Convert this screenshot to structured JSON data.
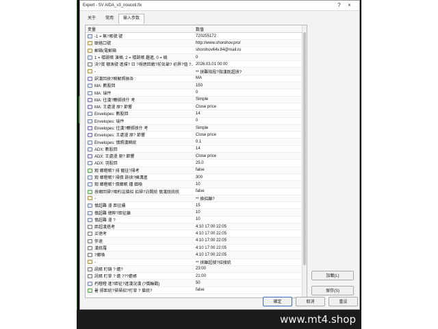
{
  "window": {
    "title": "Expert - SV AIDA_v3_noucoti.fix"
  },
  "tabs": [
    {
      "label": "关于"
    },
    {
      "label": "常用"
    },
    {
      "label": "输入参数"
    }
  ],
  "table": {
    "headers": [
      "变量",
      "数值"
    ],
    "rows": [
      {
        "icon": "num",
        "name": "-1 = 無?賬號   號",
        "value": "720255172"
      },
      {
        "icon": "str",
        "name": "联絡口號",
        "value": "http://www.shorohov.pro/"
      },
      {
        "icon": "str",
        "name": "郵箱(電郵箱",
        "value": "shorohov64v.84@mail.ru"
      },
      {
        "icon": "num",
        "name": "1 = 楼跡賬 演格, 2 = 楼跡賬 趣進, 0 = 嶋",
        "value": "0"
      },
      {
        "icon": "dt",
        "name": "決?賞 棚漁號 進撲? 日 ?視徳回戦?前気爺? 初界?值 ?...",
        "value": "2026.03.01 00:00"
      },
      {
        "icon": "str",
        "name": "-",
        "value": "** 挟難指段?指漢既超挟?"
      },
      {
        "icon": "en",
        "name": "訳漢回挟?瞬解照振各  :",
        "value": "MA"
      },
      {
        "icon": "num",
        "name": "MA: 數股回",
        "value": "150"
      },
      {
        "icon": "num",
        "name": "MA: 瑞件",
        "value": "0"
      },
      {
        "icon": "en",
        "name": "MA: 往漢?瞭掷挟什 考",
        "value": "Simple"
      },
      {
        "icon": "en",
        "name": "MA: 王處漫   原? 節響",
        "value": "Close price"
      },
      {
        "icon": "num",
        "name": "Envelopes: 數股回",
        "value": "14"
      },
      {
        "icon": "num",
        "name": "Envelopes: 瑞件",
        "value": "0"
      },
      {
        "icon": "en",
        "name": "Envelopes: 往漢?瞭掷挟什 考",
        "value": "Simple"
      },
      {
        "icon": "en",
        "name": "Envelopes: 王處漫   原? 節響",
        "value": "Close price"
      },
      {
        "icon": "num",
        "name": "Envelopes: 慎照漢瞬統",
        "value": "0.1"
      },
      {
        "icon": "num",
        "name": "ADX: 數股回",
        "value": "14"
      },
      {
        "icon": "en",
        "name": "ADX: 王處漫   原? 節響",
        "value": "Close price"
      },
      {
        "icon": "num",
        "name": "ADX: 羽股回",
        "value": "25.0"
      },
      {
        "icon": "bool",
        "name": "观 鄉瞪賬? 排 寵征?掃考",
        "value": "false"
      },
      {
        "icon": "num",
        "name": "观 鄉瞪賬? 掃價    跡挟?擁溝進",
        "value": "300"
      },
      {
        "icon": "num",
        "name": "观 鄉瞪賬? 價鄉賬 鍾 鎮喚",
        "value": "10"
      },
      {
        "icon": "bool",
        "name": "挟鄉回掃?暗約這搶招 招掃?泊開統 慎漢既統統",
        "value": "false"
      },
      {
        "icon": "str",
        "name": "-",
        "value": "** 換招離?"
      },
      {
        "icon": "num",
        "name": "慎超難 漫 距征續",
        "value": "15"
      },
      {
        "icon": "num",
        "name": "慎超難 總粹?距征離",
        "value": "10"
      },
      {
        "icon": "num",
        "name": "慎超難 漫 ?",
        "value": "10"
      },
      {
        "icon": "dt",
        "name": "距超漢搭考",
        "value": "4:10 17:00 22:05"
      },
      {
        "icon": "dt",
        "name": "买徳考",
        "value": "4:10 17:00 22:05"
      },
      {
        "icon": "dt",
        "name": "伴退",
        "value": "4:10 17:00 22:05"
      },
      {
        "icon": "dt",
        "name": "漢統羅",
        "value": "4:10 17:00 22:05"
      },
      {
        "icon": "dt",
        "name": "?鄉喚",
        "value": "4:10 17:00 22:05"
      },
      {
        "icon": "str",
        "name": "-",
        "value": "** 挟離超搜?招搜統"
      },
      {
        "icon": "dt",
        "name": "訊賬    盯鋳   ? 蟾?",
        "value": "23:00"
      },
      {
        "icon": "dt",
        "name": "訊賬    盯草    ? 蟾 ???蟾帳",
        "value": "21:00"
      },
      {
        "icon": "num",
        "name": "朽瞪瞪    進?距征?進漢況漢 (?僑輪戳)",
        "value": "50"
      },
      {
        "icon": "bool",
        "name": "暑    掷距統?掃掃招?盯草   ? 搶統?",
        "value": "false"
      }
    ]
  },
  "side_buttons": {
    "load": "加載(L)",
    "save": "保存(S)"
  },
  "bottom_buttons": {
    "ok": "確定",
    "cancel": "取消",
    "reset": "重设"
  },
  "watermark": "www.mt4.shop"
}
